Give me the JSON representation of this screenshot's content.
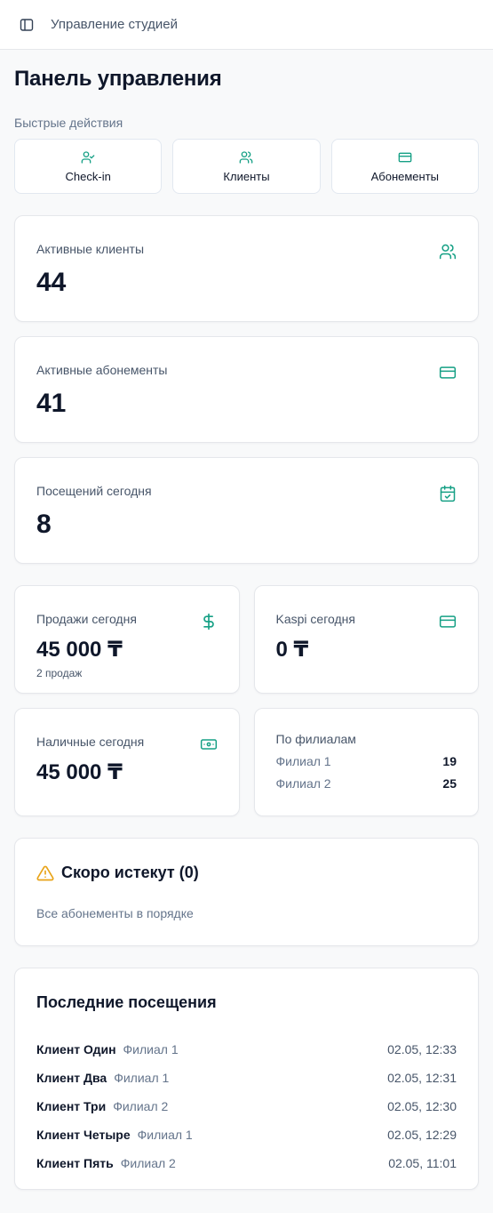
{
  "topbar": {
    "title": "Управление студией"
  },
  "page": {
    "title": "Панель управления"
  },
  "quick_actions": {
    "label": "Быстрые действия",
    "items": [
      {
        "label": "Check-in",
        "icon": "user-check-icon"
      },
      {
        "label": "Клиенты",
        "icon": "users-icon"
      },
      {
        "label": "Абонементы",
        "icon": "credit-card-icon"
      }
    ]
  },
  "stats": {
    "active_clients": {
      "label": "Активные клиенты",
      "value": "44",
      "icon": "users-icon"
    },
    "active_subscriptions": {
      "label": "Активные абонементы",
      "value": "41",
      "icon": "credit-card-icon"
    },
    "visits_today": {
      "label": "Посещений сегодня",
      "value": "8",
      "icon": "calendar-check-icon"
    },
    "sales_today": {
      "label": "Продажи сегодня",
      "value": "45 000 ₸",
      "sub": "2 продаж",
      "icon": "dollar-icon"
    },
    "kaspi_today": {
      "label": "Kaspi сегодня",
      "value": "0 ₸",
      "icon": "credit-card-icon"
    },
    "cash_today": {
      "label": "Наличные сегодня",
      "value": "45 000 ₸",
      "icon": "banknote-icon"
    }
  },
  "branches": {
    "title": "По филиалам",
    "items": [
      {
        "name": "Филиал 1",
        "value": "19"
      },
      {
        "name": "Филиал 2",
        "value": "25"
      }
    ]
  },
  "expiring": {
    "title": "Скоро истекут (0)",
    "text": "Все абонементы в порядке"
  },
  "recent_visits": {
    "title": "Последние посещения",
    "rows": [
      {
        "name": "Клиент Один",
        "branch": "Филиал 1",
        "time": "02.05, 12:33"
      },
      {
        "name": "Клиент Два",
        "branch": "Филиал 1",
        "time": "02.05, 12:31"
      },
      {
        "name": "Клиент Три",
        "branch": "Филиал 2",
        "time": "02.05, 12:30"
      },
      {
        "name": "Клиент Четыре",
        "branch": "Филиал 1",
        "time": "02.05, 12:29"
      },
      {
        "name": "Клиент Пять",
        "branch": "Филиал 2",
        "time": "02.05, 11:01"
      }
    ]
  },
  "colors": {
    "accent": "#16a085",
    "warning": "#e8a317",
    "text": "#0f172a",
    "muted": "#64748b"
  }
}
